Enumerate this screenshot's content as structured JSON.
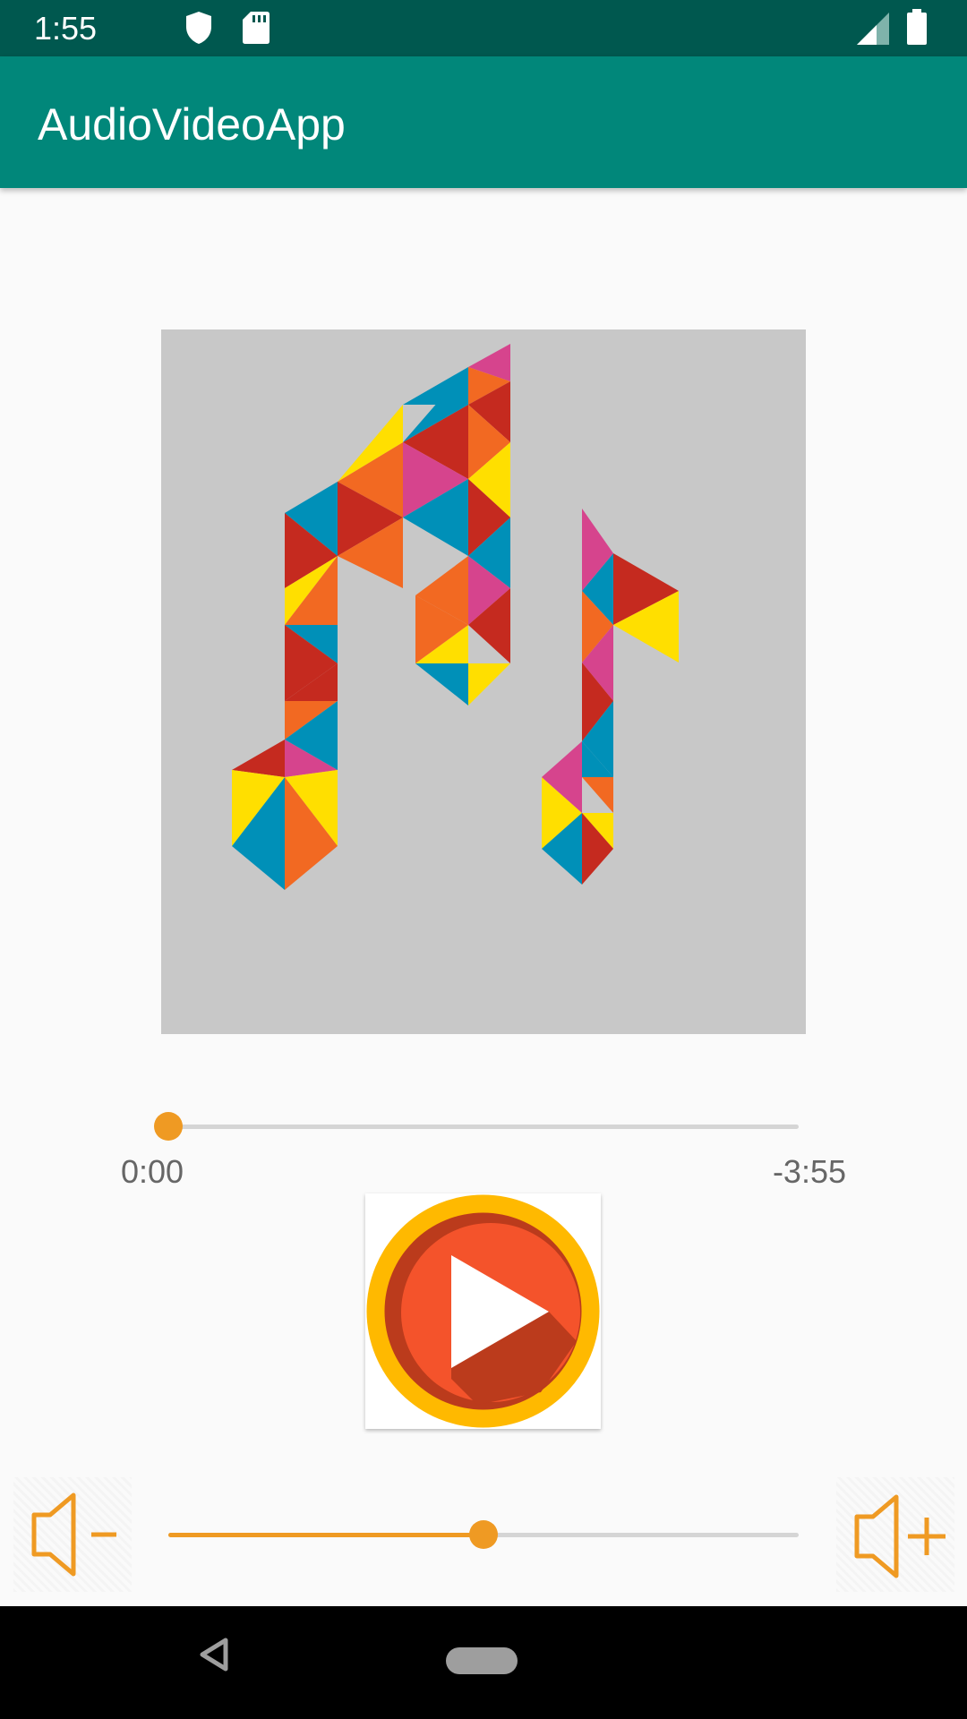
{
  "status_bar": {
    "time": "1:55",
    "icons": [
      "shield-icon",
      "sd-card-icon",
      "signal-icon",
      "battery-icon"
    ]
  },
  "app_bar": {
    "title": "AudioVideoApp"
  },
  "player": {
    "album_art": "music-notes-icon",
    "progress": 0.0,
    "elapsed": "0:00",
    "remaining": "-3:55",
    "play_button": "play-icon",
    "volume_level": 0.5,
    "volume_down": "volume-down-icon",
    "volume_up": "volume-up-icon"
  },
  "nav_bar": {
    "icons": [
      "back-icon",
      "home-icon"
    ]
  },
  "colors": {
    "status_bar": "#00584f",
    "app_bar": "#01877a",
    "accent": "#ef9a23",
    "play_ring": "#ffb900",
    "play_fill": "#f4532b"
  }
}
